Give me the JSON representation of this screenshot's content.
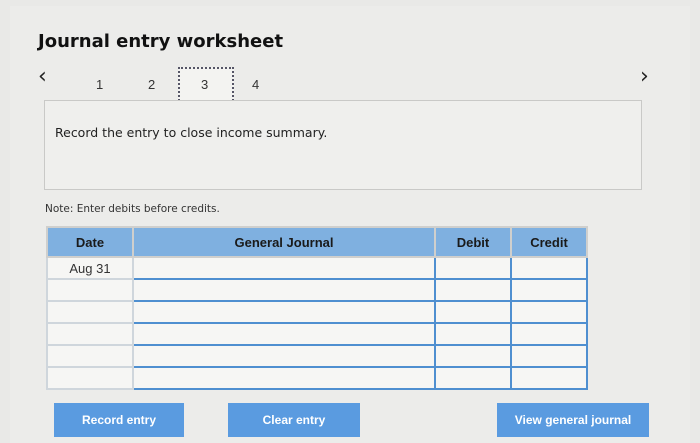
{
  "title": "Journal entry worksheet",
  "nav": {
    "prev_icon": "‹",
    "next_icon": "›",
    "steps": [
      "1",
      "2",
      "3",
      "4"
    ],
    "active_step": 3
  },
  "instruction": "Record the entry to close income summary.",
  "note": "Note: Enter debits before credits.",
  "table": {
    "headers": [
      "Date",
      "General Journal",
      "Debit",
      "Credit"
    ],
    "rows": [
      [
        "Aug 31",
        "",
        "",
        ""
      ],
      [
        "",
        "",
        "",
        ""
      ],
      [
        "",
        "",
        "",
        ""
      ],
      [
        "",
        "",
        "",
        ""
      ],
      [
        "",
        "",
        "",
        ""
      ],
      [
        "",
        "",
        "",
        ""
      ]
    ]
  },
  "buttons": {
    "record": "Record entry",
    "clear": "Clear entry",
    "view": "View general journal"
  },
  "colors": {
    "header_blue": "#7fb0e0",
    "button_blue": "#5a9be0"
  }
}
